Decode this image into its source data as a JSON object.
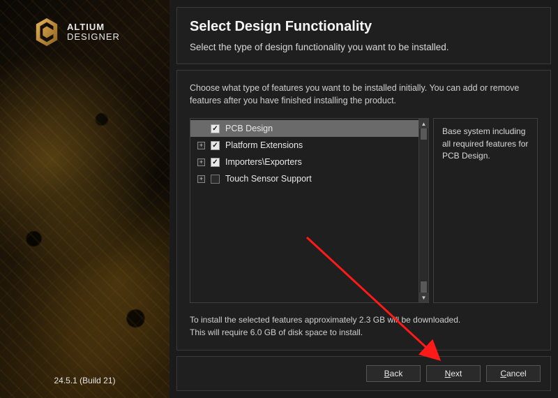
{
  "brand": {
    "line1": "ALTIUM",
    "line2": "DESIGNER"
  },
  "version": "24.5.1 (Build 21)",
  "header": {
    "title": "Select Design Functionality",
    "subtitle": "Select the type of design functionality you want to be installed."
  },
  "body": {
    "instruction": "Choose what type of features you want to be installed initially. You can add or remove features after you have finished installing the product.",
    "features": [
      {
        "label": "PCB Design",
        "checked": true,
        "expandable": false,
        "selected": true
      },
      {
        "label": "Platform Extensions",
        "checked": true,
        "expandable": true,
        "selected": false
      },
      {
        "label": "Importers\\Exporters",
        "checked": true,
        "expandable": true,
        "selected": false
      },
      {
        "label": "Touch Sensor Support",
        "checked": false,
        "expandable": true,
        "selected": false
      }
    ],
    "description": "Base system including all required features for PCB Design.",
    "footnote_line1": "To install the selected features approximately 2.3 GB will be downloaded.",
    "footnote_line2": "This will require 6.0 GB of disk space to install."
  },
  "footer": {
    "back": "Back",
    "next": "Next",
    "cancel": "Cancel"
  }
}
